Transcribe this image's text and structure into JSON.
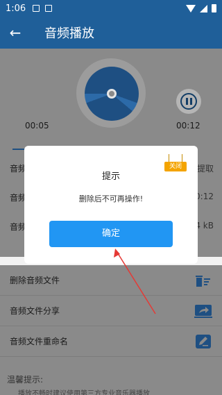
{
  "status_bar": {
    "time": "1:06"
  },
  "app_bar": {
    "title": "音频播放"
  },
  "player": {
    "current_time": "00:05",
    "total_time": "00:12"
  },
  "info": {
    "rows": [
      {
        "label": "音频",
        "value": "提取"
      },
      {
        "label": "音频",
        "value": "0:12"
      },
      {
        "label": "音频",
        "value": "4 kB"
      }
    ]
  },
  "actions": [
    {
      "label": "删除音频文件",
      "icon": "delete-list-icon"
    },
    {
      "label": "音频文件分享",
      "icon": "share-icon"
    },
    {
      "label": "音频文件重命名",
      "icon": "edit-icon"
    }
  ],
  "tips": {
    "title": "温馨提示:",
    "line": "播放不畅时建议使用第三方专业音乐器播放"
  },
  "dialog": {
    "title": "提示",
    "message": "删除后不可再操作!",
    "close_label": "关闭",
    "confirm_label": "确定"
  },
  "colors": {
    "primary": "#1f5f99",
    "button": "#2196f3",
    "close_tag": "#f4a400",
    "arrow": "#e53935"
  }
}
